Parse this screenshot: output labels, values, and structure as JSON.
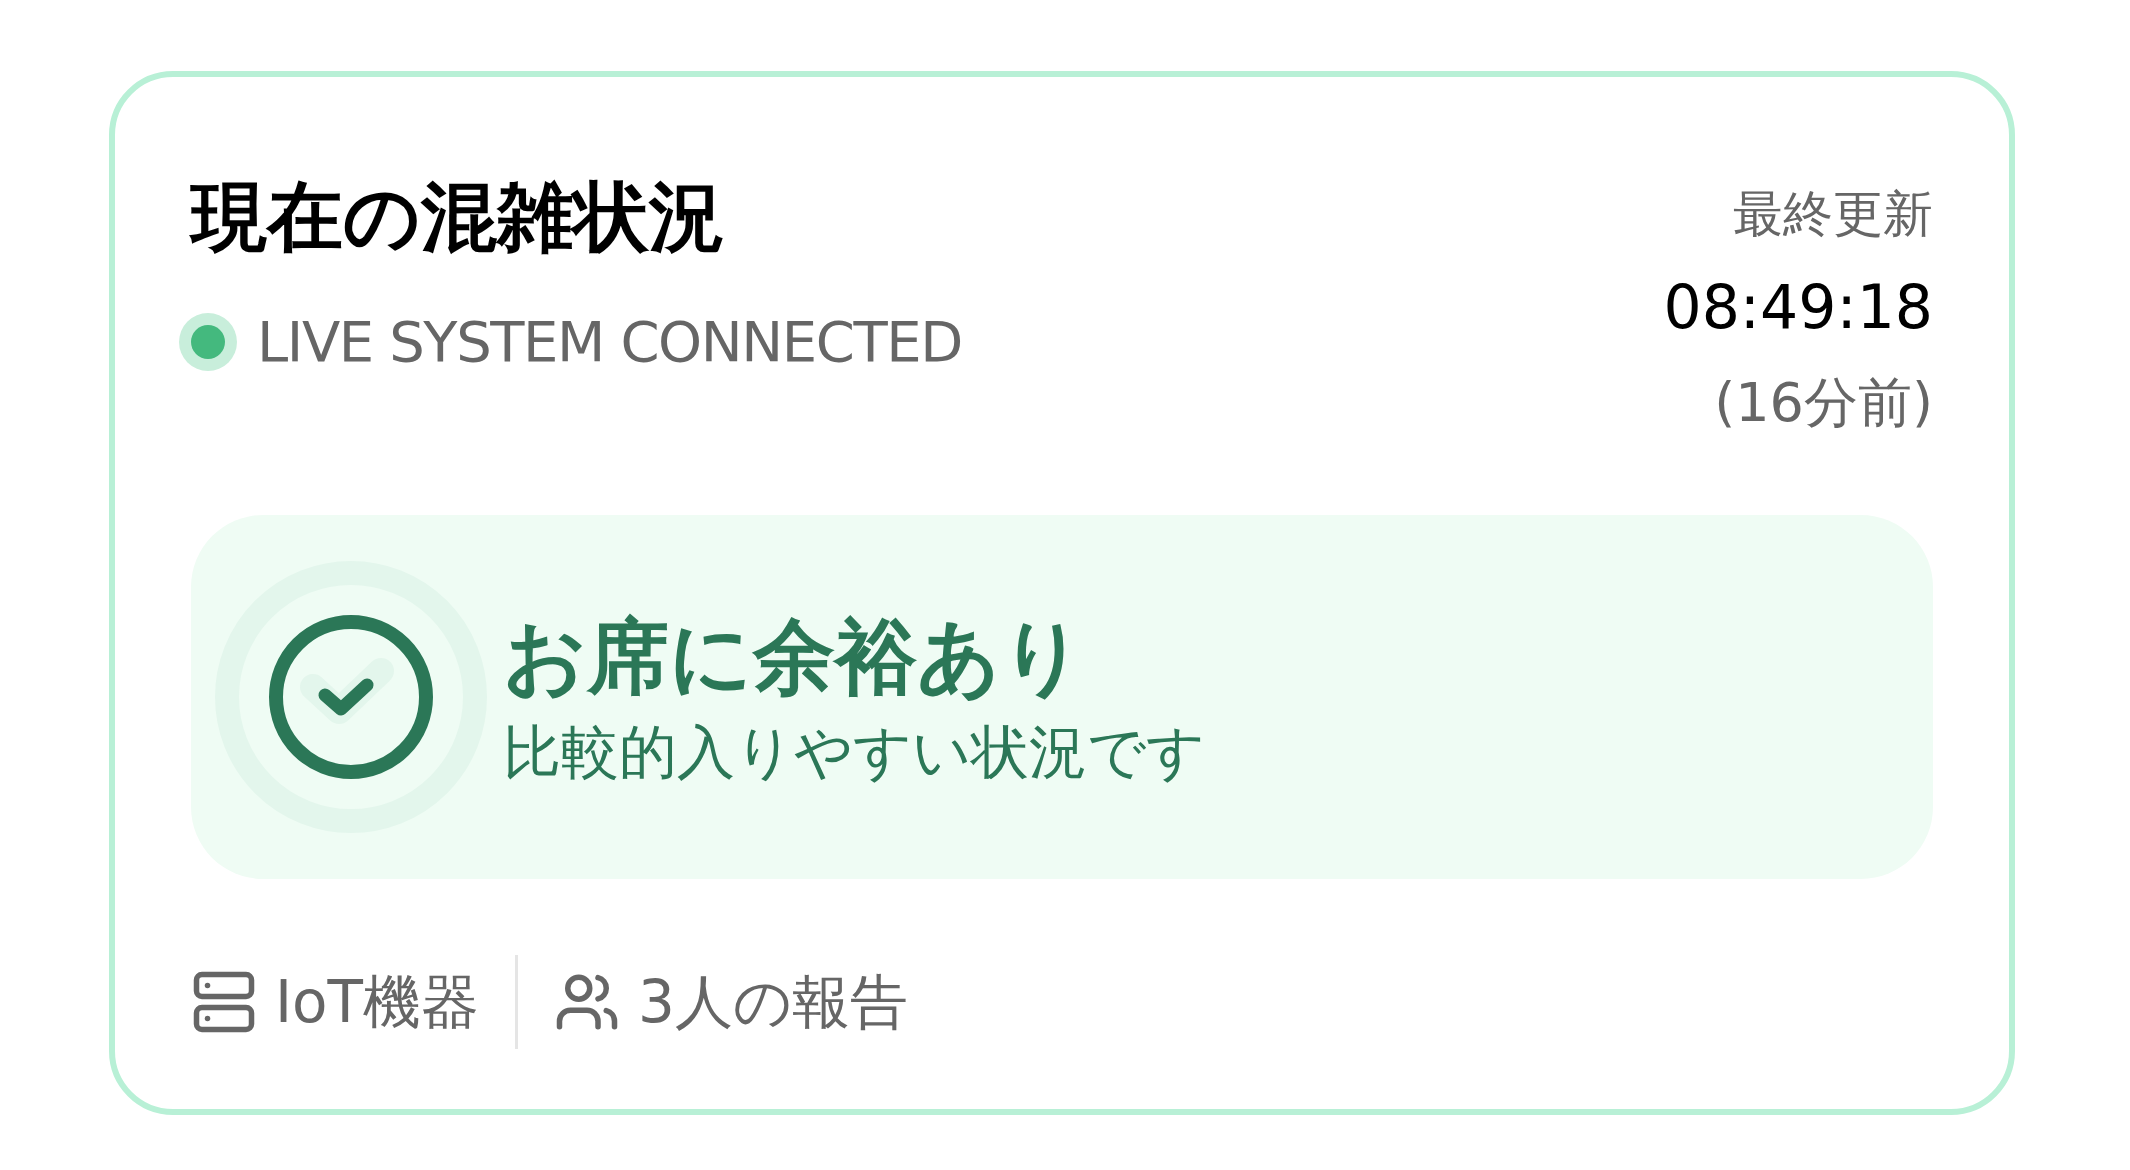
{
  "header": {
    "title": "現在の混雑状況",
    "connection": {
      "label": "LIVE SYSTEM CONNECTED",
      "connected": true
    }
  },
  "last_update": {
    "label": "最終更新",
    "time": "08:49:18",
    "ago": "(16分前)"
  },
  "status": {
    "kind": "available",
    "title": "お席に余裕あり",
    "subtitle": "比較的入りやすい状況です"
  },
  "sources": [
    {
      "kind": "iot",
      "label": "IoT機器"
    },
    {
      "kind": "reports",
      "label": "3人の報告"
    }
  ]
}
